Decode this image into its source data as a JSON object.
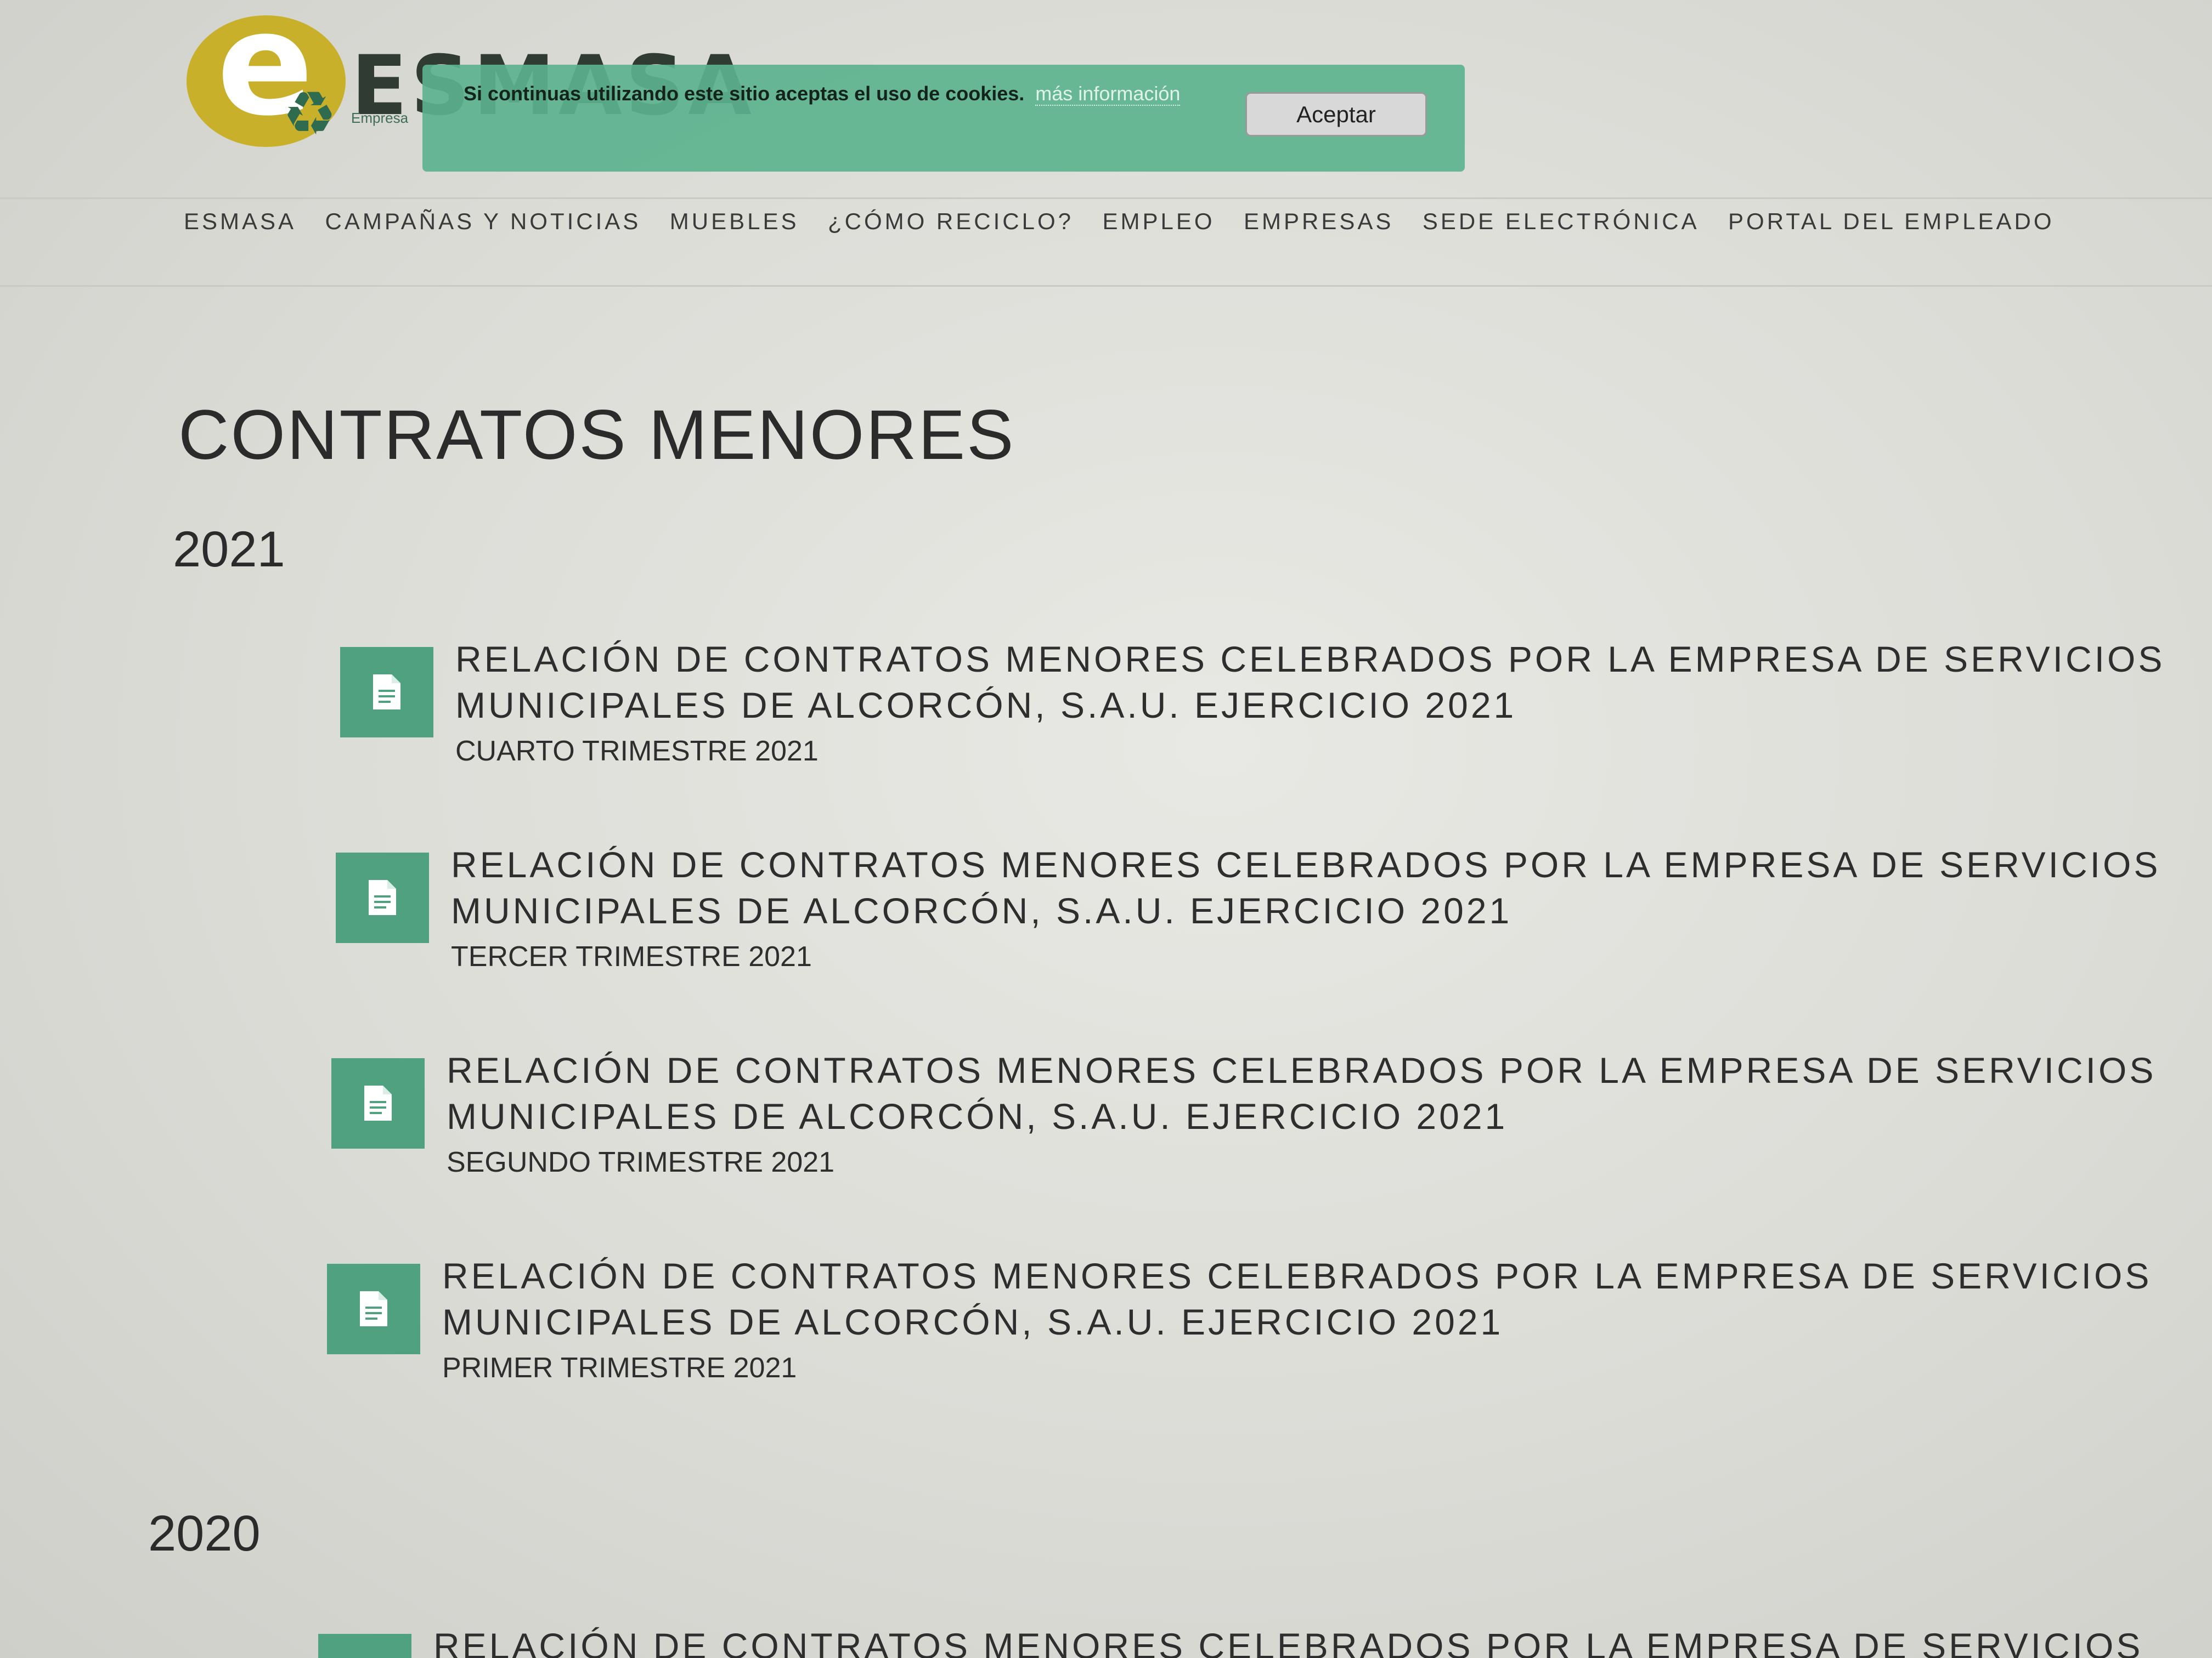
{
  "header": {
    "logo_text": "ESMASA",
    "logo_subtitle": "Empresa"
  },
  "cookie_bar": {
    "message": "Si continuas utilizando este sitio aceptas el uso de cookies.",
    "link": "más información",
    "accept_label": "Aceptar"
  },
  "nav": {
    "items": [
      {
        "label": "ESMASA"
      },
      {
        "label": "CAMPAÑAS Y NOTICIAS"
      },
      {
        "label": "MUEBLES"
      },
      {
        "label": "¿CÓMO RECICLO?"
      },
      {
        "label": "EMPLEO"
      },
      {
        "label": "EMPRESAS"
      },
      {
        "label": "SEDE ELECTRÓNICA"
      },
      {
        "label": "PORTAL DEL EMPLEADO"
      }
    ]
  },
  "main": {
    "title": "CONTRATOS MENORES",
    "years": [
      {
        "year": "2021",
        "documents": [
          {
            "title": "RELACIÓN DE CONTRATOS MENORES CELEBRADOS POR LA EMPRESA DE SERVICIOS MUNICIPALES DE ALCORCÓN, S.A.U. EJERCICIO 2021",
            "subtitle": "CUARTO TRIMESTRE 2021",
            "icon": "document-icon"
          },
          {
            "title": "RELACIÓN DE CONTRATOS MENORES CELEBRADOS POR LA EMPRESA DE SERVICIOS MUNICIPALES DE ALCORCÓN, S.A.U. EJERCICIO 2021",
            "subtitle": "TERCER TRIMESTRE 2021",
            "icon": "document-icon"
          },
          {
            "title": "RELACIÓN DE CONTRATOS MENORES CELEBRADOS POR LA EMPRESA DE SERVICIOS MUNICIPALES DE ALCORCÓN, S.A.U. EJERCICIO 2021",
            "subtitle": "SEGUNDO TRIMESTRE 2021",
            "icon": "document-icon"
          },
          {
            "title": "RELACIÓN DE CONTRATOS MENORES CELEBRADOS POR LA EMPRESA DE SERVICIOS MUNICIPALES DE ALCORCÓN, S.A.U. EJERCICIO 2021",
            "subtitle": "PRIMER TRIMESTRE 2021",
            "icon": "document-icon"
          }
        ]
      },
      {
        "year": "2020",
        "documents": [
          {
            "title": "RELACIÓN DE CONTRATOS MENORES CELEBRADOS POR LA EMPRESA DE SERVICIOS",
            "icon": "document-icon"
          }
        ]
      }
    ]
  },
  "colors": {
    "accent": "#4fa17f",
    "cookie_bar": "#5cb28e",
    "logo_yellow": "#c9b02a",
    "logo_green": "#2f6b4f"
  }
}
